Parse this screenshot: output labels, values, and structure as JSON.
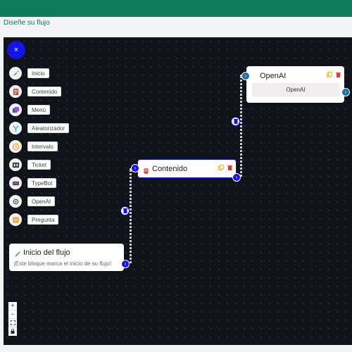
{
  "header": {
    "page_title": "Diseñe su flujo"
  },
  "toolbar": {
    "close_label": "×"
  },
  "palette": {
    "items": [
      {
        "label": "Inicio",
        "icon": "rocket-icon",
        "color": "#2e8b3a"
      },
      {
        "label": "Contenido",
        "icon": "content-icon",
        "color": "#d9463b"
      },
      {
        "label": "Menú",
        "icon": "menu-icon",
        "color": "#6a3fb5"
      },
      {
        "label": "Aleatorizador",
        "icon": "randomizer-icon",
        "color": "#2bb3c0"
      },
      {
        "label": "Intervalo",
        "icon": "clock-icon",
        "color": "#e9a23b"
      },
      {
        "label": "Ticket",
        "icon": "ticket-icon",
        "color": "#333333"
      },
      {
        "label": "TypeBot",
        "icon": "typebot-icon",
        "color": "#555555"
      },
      {
        "label": "OpenAI",
        "icon": "openai-icon",
        "color": "#444444"
      },
      {
        "label": "Pregunta",
        "icon": "question-icon",
        "color": "#e9a23b"
      }
    ]
  },
  "nodes": {
    "start": {
      "title": "Inicio del flujo",
      "subtitle": "¡Este bloque marca el inicio de su flujo!"
    },
    "content": {
      "title": "Contenido"
    },
    "openai": {
      "title": "OpenAI",
      "body": "OpenAI"
    }
  },
  "zoom_controls": {
    "zoom_in": "+",
    "zoom_out": "−",
    "fit": "⛶",
    "lock": "🔒"
  },
  "colors": {
    "accent": "#0f7a5a",
    "handle": "#1414e6",
    "delete": "#e53935",
    "copy": "#f0a500"
  }
}
